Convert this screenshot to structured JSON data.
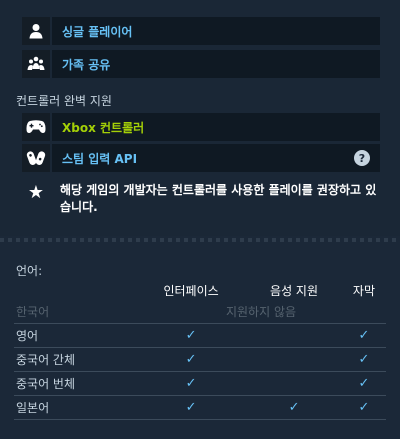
{
  "features": {
    "single_player": "싱글 플레이어",
    "family_share": "가족 공유"
  },
  "controller": {
    "section_title": "컨트롤러 완벽 지원",
    "xbox": "Xbox 컨트롤러",
    "steam_input": "스팀 입력 API",
    "help_label": "?",
    "note": "해당 게임의 개발자는 컨트롤러를 사용한 플레이를 권장하고 있습니다."
  },
  "languages": {
    "title": "언어:",
    "headers": [
      "인터페이스",
      "음성 지원",
      "자막"
    ],
    "unsupported_text": "지원하지 않음",
    "check_glyph": "✓",
    "rows": [
      {
        "name": "한국어",
        "supported": false,
        "interface": false,
        "audio": false,
        "subtitles": false
      },
      {
        "name": "영어",
        "supported": true,
        "interface": true,
        "audio": false,
        "subtitles": true
      },
      {
        "name": "중국어 간체",
        "supported": true,
        "interface": true,
        "audio": false,
        "subtitles": true
      },
      {
        "name": "중국어 번체",
        "supported": true,
        "interface": true,
        "audio": false,
        "subtitles": true
      },
      {
        "name": "일본어",
        "supported": true,
        "interface": true,
        "audio": true,
        "subtitles": true
      }
    ]
  },
  "colors": {
    "link_blue": "#67c1f5",
    "xbox_green": "#a4d007",
    "background": "#1b2838"
  }
}
